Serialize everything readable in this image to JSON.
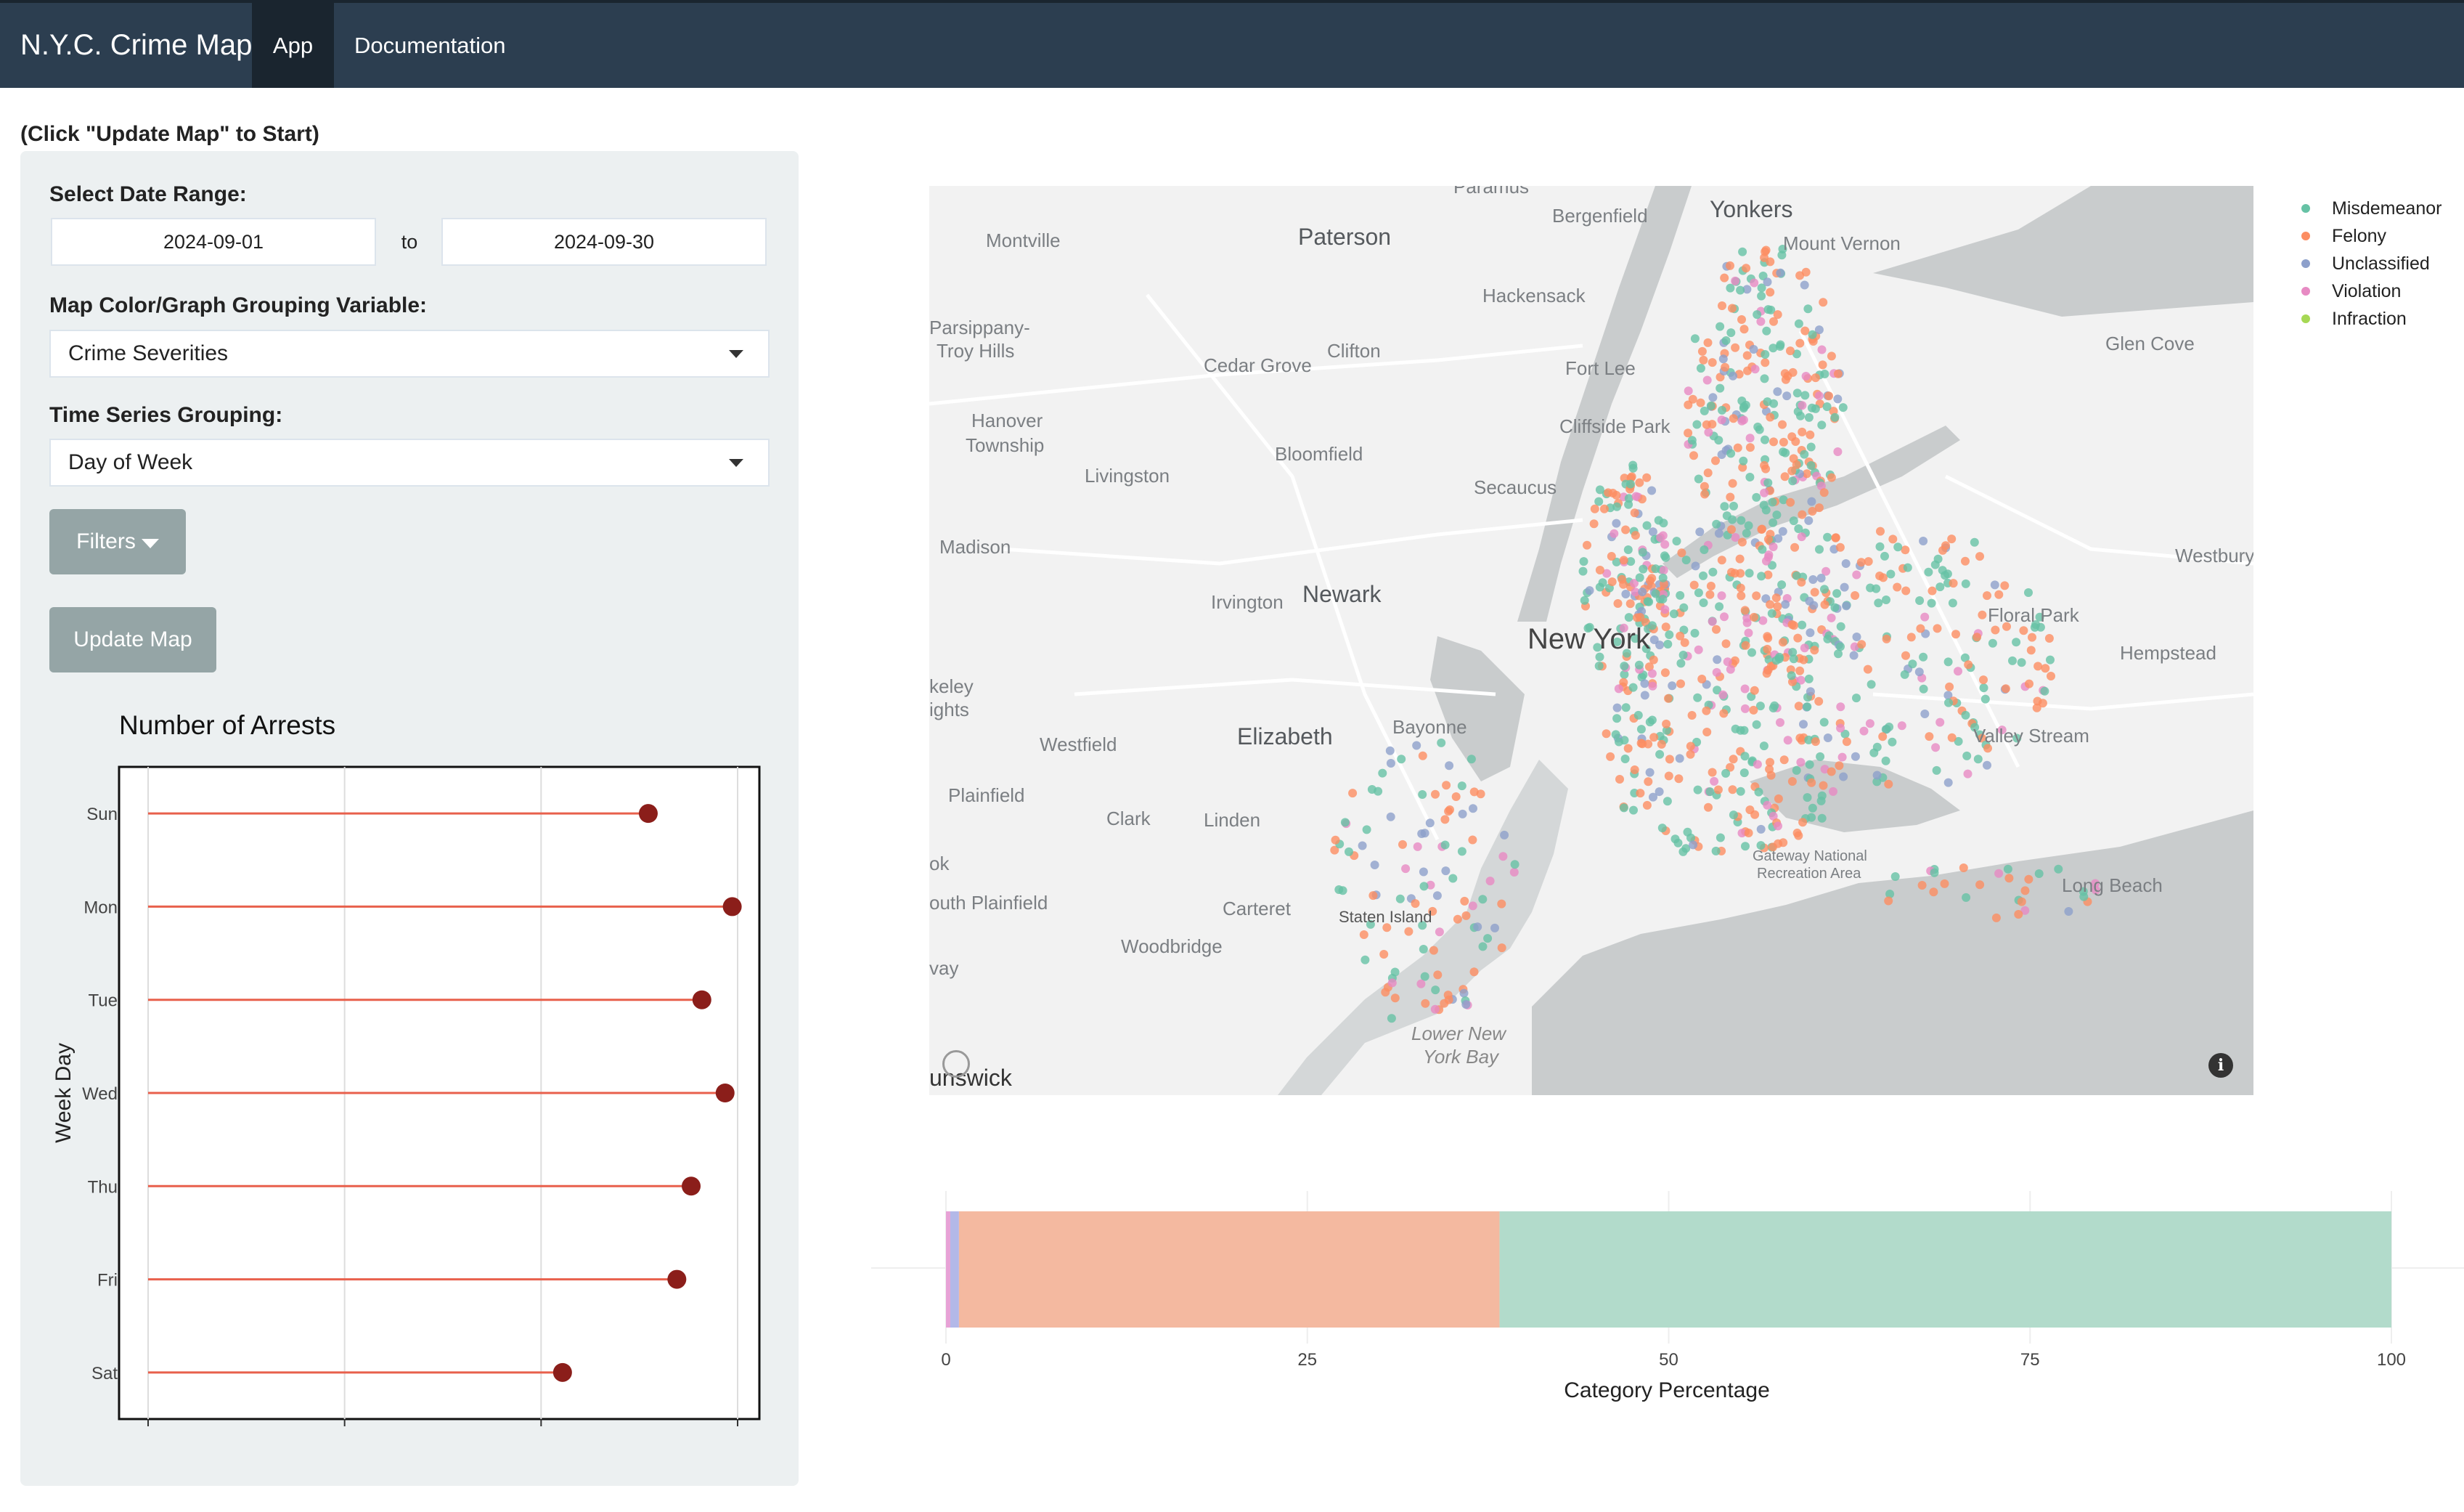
{
  "navbar": {
    "brand": "N.Y.C. Crime Map",
    "tabs": [
      "App",
      "Documentation"
    ]
  },
  "hint": "(Click \"Update Map\" to Start)",
  "sidebar": {
    "date_range_label": "Select Date Range:",
    "date_start": "2024-09-01",
    "date_separator": "to",
    "date_end": "2024-09-30",
    "grouping_label": "Map Color/Graph Grouping Variable:",
    "grouping_value": "Crime Severities",
    "ts_label": "Time Series Grouping:",
    "ts_value": "Day of Week",
    "filters_button": "Filters",
    "update_button": "Update Map"
  },
  "chart_data": [
    {
      "type": "lollipop",
      "title": "Number of Arrests",
      "ylabel": "Week Day",
      "categories": [
        "Sun",
        "Mon",
        "Tue",
        "Wed",
        "Thu",
        "Fri",
        "Sat"
      ],
      "values": [
        2800,
        3270,
        3100,
        3230,
        3040,
        2960,
        2320
      ],
      "xlim": [
        0,
        3300
      ],
      "color": "#e8604c",
      "point_color": "#8b1e1a"
    },
    {
      "type": "bar",
      "orientation": "horizontal-stacked",
      "xlabel": "Category Percentage",
      "xticks": [
        "0",
        "25",
        "50",
        "75",
        "100"
      ],
      "xlim": [
        0,
        100
      ],
      "series": [
        {
          "name": "Violation",
          "values": [
            0.3
          ],
          "color": "#e7a2d6"
        },
        {
          "name": "Unclassified",
          "values": [
            0.6
          ],
          "color": "#b3b8e8"
        },
        {
          "name": "Felony",
          "values": [
            37.4
          ],
          "color": "#f4b9a0"
        },
        {
          "name": "Misdemeanor",
          "values": [
            61.7
          ],
          "color": "#b2dbcb"
        }
      ]
    }
  ],
  "legend": [
    {
      "label": "Misdemeanor",
      "color": "#66c2a5"
    },
    {
      "label": "Felony",
      "color": "#fc8d62"
    },
    {
      "label": "Unclassified",
      "color": "#8da0cb"
    },
    {
      "label": "Violation",
      "color": "#e78ac3"
    },
    {
      "label": "Infraction",
      "color": "#a6d854"
    }
  ],
  "map": {
    "labels": {
      "paterson": "Paterson",
      "yonkers": "Yonkers",
      "bergenfield": "Bergenfield",
      "mount_vernon": "Mount Vernon",
      "montville": "Montville",
      "hackensack": "Hackensack",
      "parsippany": "Parsippany-",
      "troy_hills": "Troy Hills",
      "cedar_grove": "Cedar Grove",
      "clifton": "Clifton",
      "glen_cove": "Glen Cove",
      "fort_lee": "Fort Lee",
      "hanover": "Hanover",
      "township": "Township",
      "cliffside": "Cliffside Park",
      "bloomfield": "Bloomfield",
      "livingston": "Livingston",
      "secaucus": "Secaucus",
      "madison": "Madison",
      "westbury": "Westbury",
      "irvington": "Irvington",
      "newark": "Newark",
      "floral_park": "Floral Park",
      "new_york": "New York",
      "hempstead": "Hempstead",
      "keley": "keley",
      "ights": "ights",
      "elizabeth": "Elizabeth",
      "bayonne": "Bayonne",
      "valley_stream": "Valley Stream",
      "westfield": "Westfield",
      "plainfield": "Plainfield",
      "clark": "Clark",
      "linden": "Linden",
      "ok": "ok",
      "south_plainfield": "outh Plainfield",
      "gateway": "Gateway National",
      "recreation": "Recreation Area",
      "carteret": "Carteret",
      "staten_island": "Staten Island",
      "long_beach": "Long Beach",
      "woodbridge": "Woodbridge",
      "vay": "vay",
      "lower_ny_bay1": "Lower New",
      "lower_ny_bay2": "York Bay",
      "nswick": "unswick",
      "paramus": "Paramus"
    }
  }
}
